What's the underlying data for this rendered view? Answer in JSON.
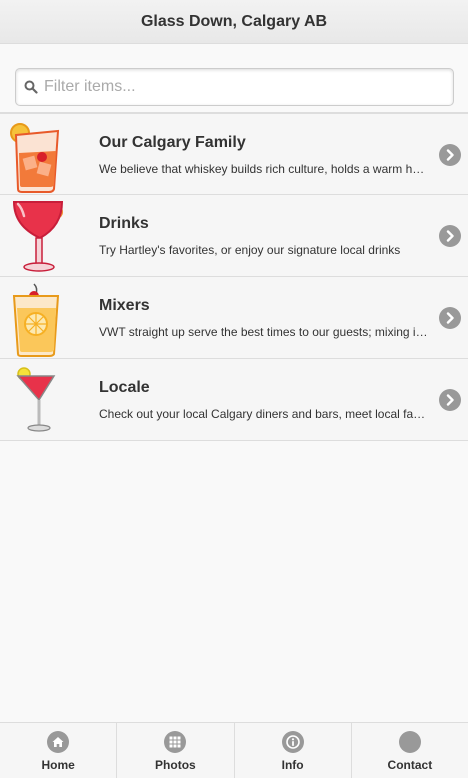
{
  "header": {
    "title": "Glass Down, Calgary AB"
  },
  "search": {
    "placeholder": "Filter items...",
    "icon": "search-icon"
  },
  "list": {
    "items": [
      {
        "title": "Our Calgary Family",
        "description": "We believe that whiskey builds rich culture, holds a warm heart, and brings family together",
        "icon": "old-fashioned-glass-icon"
      },
      {
        "title": "Drinks",
        "description": "Try Hartley's favorites, or enjoy our signature local drinks",
        "icon": "cocktail-glass-icon"
      },
      {
        "title": "Mixers",
        "description": "VWT straight up serve the best times to our guests; mixing in good company",
        "icon": "lemon-cocktail-icon"
      },
      {
        "title": "Locale",
        "description": "Check out your local Calgary diners and bars, meet local favorites",
        "icon": "martini-glass-icon"
      }
    ]
  },
  "tabs": [
    {
      "label": "Home",
      "icon": "home-icon"
    },
    {
      "label": "Photos",
      "icon": "grid-icon"
    },
    {
      "label": "Info",
      "icon": "info-icon"
    },
    {
      "label": "Contact",
      "icon": "contact-icon"
    }
  ],
  "colors": {
    "icon_gray": "#999999",
    "drink_red": "#e8324a",
    "drink_orange": "#f08a2e"
  }
}
